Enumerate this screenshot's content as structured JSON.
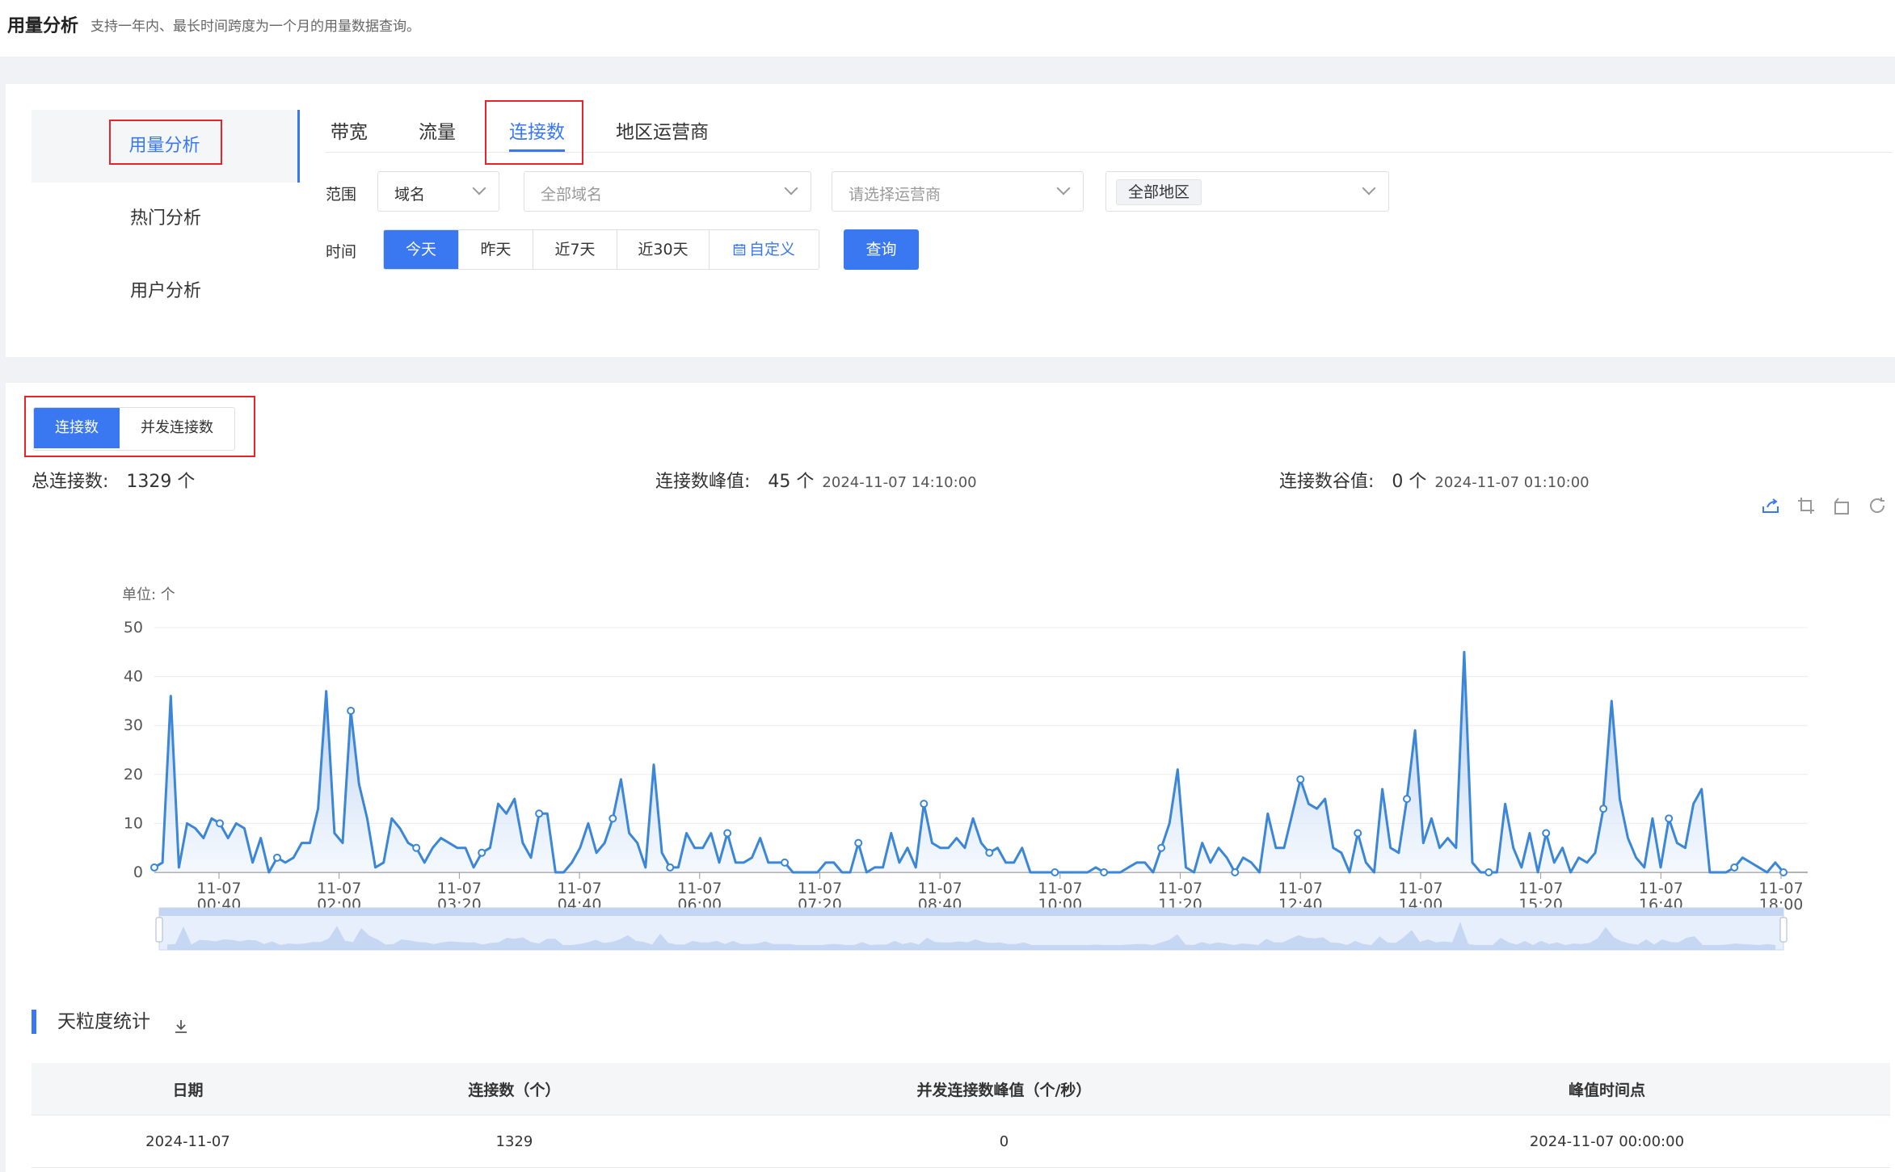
{
  "header": {
    "title": "用量分析",
    "description": "支持一年内、最长时间跨度为一个月的用量数据查询。"
  },
  "sidebar": {
    "items": [
      {
        "label": "用量分析",
        "active": true
      },
      {
        "label": "热门分析",
        "active": false
      },
      {
        "label": "用户分析",
        "active": false
      }
    ]
  },
  "tabs": [
    {
      "label": "带宽",
      "active": false
    },
    {
      "label": "流量",
      "active": false
    },
    {
      "label": "连接数",
      "active": true
    },
    {
      "label": "地区运营商",
      "active": false
    }
  ],
  "filters": {
    "range_label": "范围",
    "scope_value": "域名",
    "domain_placeholder": "全部域名",
    "isp_placeholder": "请选择运营商",
    "region_value": "全部地区",
    "time_label": "时间",
    "time_options": [
      "今天",
      "昨天",
      "近7天",
      "近30天",
      "自定义"
    ],
    "time_selected": "今天",
    "query_button": "查询"
  },
  "metric_toggle": {
    "options": [
      "连接数",
      "并发连接数"
    ],
    "selected": "连接数"
  },
  "stats": {
    "total_label": "总连接数:",
    "total_value": "1329 个",
    "peak_label": "连接数峰值:",
    "peak_value": "45 个",
    "peak_time": "2024-11-07 14:10:00",
    "valley_label": "连接数谷值:",
    "valley_value": "0 个",
    "valley_time": "2024-11-07 01:10:00"
  },
  "toolbar_icons": [
    "save-image-icon",
    "zoom-select-icon",
    "zoom-reset-icon",
    "restore-icon"
  ],
  "chart_data": {
    "type": "area",
    "unit_label": "单位: 个",
    "ylim": [
      0,
      50
    ],
    "yticks": [
      0,
      10,
      20,
      30,
      40,
      50
    ],
    "x_start": "00:00",
    "x_end": "18:00",
    "x_ticks": [
      "11-07 00:40",
      "11-07 02:00",
      "11-07 03:20",
      "11-07 04:40",
      "11-07 06:00",
      "11-07 07:20",
      "11-07 08:40",
      "11-07 10:00",
      "11-07 11:20",
      "11-07 12:40",
      "11-07 14:00",
      "11-07 15:20",
      "11-07 16:40",
      "11-07 18:00"
    ],
    "series": [
      {
        "color": "#3b86d6",
        "values": [
          1,
          2,
          36,
          1,
          10,
          9,
          7,
          11,
          10,
          7,
          10,
          9,
          2,
          7,
          0,
          3,
          2,
          3,
          6,
          6,
          13,
          37,
          8,
          6,
          33,
          18,
          11,
          1,
          2,
          11,
          9,
          6,
          5,
          2,
          5,
          7,
          6,
          5,
          5,
          1,
          4,
          5,
          14,
          12,
          15,
          6,
          3,
          12,
          12,
          0,
          0,
          2,
          5,
          10,
          4,
          6,
          11,
          19,
          8,
          6,
          1,
          22,
          4,
          1,
          1,
          8,
          5,
          5,
          8,
          2,
          8,
          2,
          2,
          3,
          7,
          2,
          2,
          2,
          0,
          0,
          0,
          0,
          2,
          2,
          0,
          0,
          6,
          0,
          1,
          1,
          8,
          2,
          5,
          1,
          14,
          6,
          5,
          5,
          7,
          5,
          11,
          6,
          4,
          5,
          2,
          2,
          5,
          0,
          0,
          0,
          0,
          0,
          0,
          0,
          0,
          1,
          0,
          0,
          0,
          1,
          2,
          2,
          0,
          5,
          10,
          21,
          1,
          0,
          6,
          2,
          5,
          3,
          0,
          3,
          2,
          0,
          12,
          5,
          5,
          12,
          19,
          14,
          13,
          15,
          5,
          4,
          0,
          8,
          2,
          0,
          17,
          5,
          4,
          15,
          29,
          6,
          11,
          5,
          7,
          5,
          45,
          2,
          0,
          0,
          0,
          14,
          5,
          1,
          8,
          0,
          8,
          2,
          5,
          0,
          3,
          2,
          4,
          13,
          35,
          15,
          7,
          3,
          1,
          11,
          1,
          11,
          6,
          5,
          14,
          17,
          0,
          0,
          0,
          1,
          3,
          2,
          1,
          0,
          2,
          0
        ]
      }
    ]
  },
  "range_slider": {
    "start": 0,
    "end": 100
  },
  "daily_stats": {
    "title": "天粒度统计",
    "columns": [
      "日期",
      "连接数（个）",
      "并发连接数峰值（个/秒）",
      "峰值时间点"
    ],
    "rows": [
      [
        "2024-11-07",
        "1329",
        "0",
        "2024-11-07 00:00:00"
      ]
    ]
  }
}
